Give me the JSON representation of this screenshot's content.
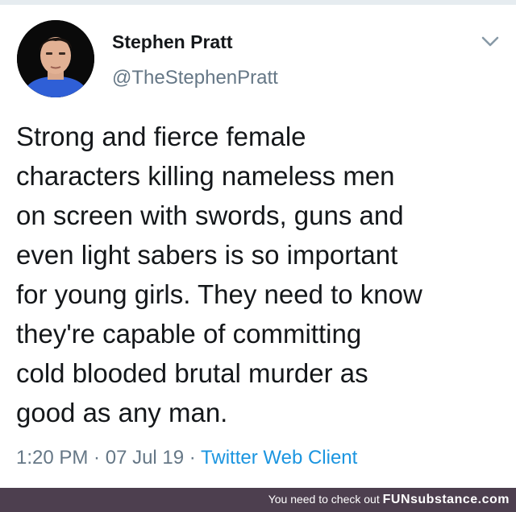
{
  "tweet": {
    "display_name": "Stephen Pratt",
    "handle": "@TheStephenPratt",
    "text_lines": [
      "Strong and fierce female",
      "characters killing nameless men",
      "on screen with swords, guns and",
      "even light sabers is so important",
      "for young girls. They need to know",
      "they're capable of committing",
      "cold blooded brutal murder as",
      "good as any man."
    ],
    "time": "1:20 PM",
    "separator": " · ",
    "date": "07 Jul 19",
    "source": "Twitter Web Client",
    "menu_icon": "chevron-down-icon",
    "avatar_icon": "profile-photo"
  },
  "footer": {
    "prefix": "You need to check out ",
    "brand": "FUNsubstance.com"
  },
  "colors": {
    "text": "#14171a",
    "secondary": "#657786",
    "link": "#1b95e0",
    "footer_bg": "#4d3f4f"
  }
}
